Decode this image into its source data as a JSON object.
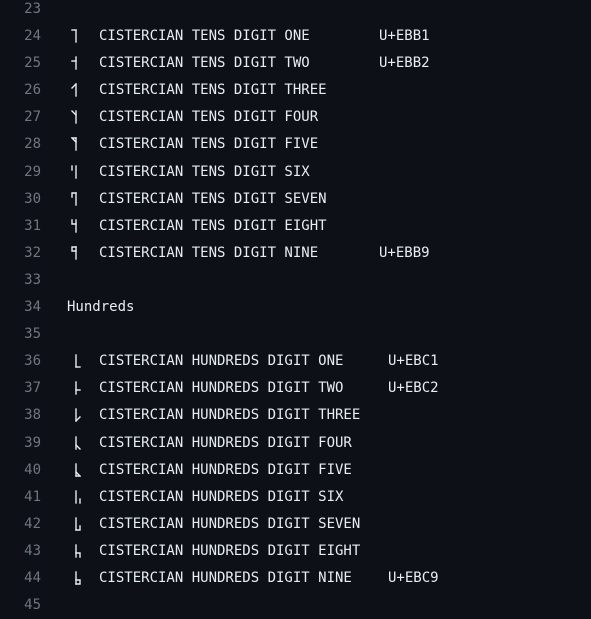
{
  "editor": {
    "lines": [
      {
        "num": "23",
        "text": ""
      },
      {
        "num": "24",
        "glyph": "tens-1",
        "name": "CISTERCIAN TENS DIGIT ONE",
        "cp": "U+EBB1"
      },
      {
        "num": "25",
        "glyph": "tens-2",
        "name": "CISTERCIAN TENS DIGIT TWO",
        "cp": "U+EBB2"
      },
      {
        "num": "26",
        "glyph": "tens-3",
        "name": "CISTERCIAN TENS DIGIT THREE"
      },
      {
        "num": "27",
        "glyph": "tens-4",
        "name": "CISTERCIAN TENS DIGIT FOUR"
      },
      {
        "num": "28",
        "glyph": "tens-5",
        "name": "CISTERCIAN TENS DIGIT FIVE"
      },
      {
        "num": "29",
        "glyph": "tens-6",
        "name": "CISTERCIAN TENS DIGIT SIX"
      },
      {
        "num": "30",
        "glyph": "tens-7",
        "name": "CISTERCIAN TENS DIGIT SEVEN"
      },
      {
        "num": "31",
        "glyph": "tens-8",
        "name": "CISTERCIAN TENS DIGIT EIGHT"
      },
      {
        "num": "32",
        "glyph": "tens-9",
        "name": "CISTERCIAN TENS DIGIT NINE",
        "cp": "U+EBB9"
      },
      {
        "num": "33",
        "text": ""
      },
      {
        "num": "34",
        "text": "Hundreds"
      },
      {
        "num": "35",
        "text": ""
      },
      {
        "num": "36",
        "glyph": "hund-1",
        "name": "CISTERCIAN HUNDREDS DIGIT ONE",
        "cp": "U+EBC1"
      },
      {
        "num": "37",
        "glyph": "hund-2",
        "name": "CISTERCIAN HUNDREDS DIGIT TWO",
        "cp": "U+EBC2"
      },
      {
        "num": "38",
        "glyph": "hund-3",
        "name": "CISTERCIAN HUNDREDS DIGIT THREE"
      },
      {
        "num": "39",
        "glyph": "hund-4",
        "name": "CISTERCIAN HUNDREDS DIGIT FOUR"
      },
      {
        "num": "40",
        "glyph": "hund-5",
        "name": "CISTERCIAN HUNDREDS DIGIT FIVE"
      },
      {
        "num": "41",
        "glyph": "hund-6",
        "name": "CISTERCIAN HUNDREDS DIGIT SIX"
      },
      {
        "num": "42",
        "glyph": "hund-7",
        "name": "CISTERCIAN HUNDREDS DIGIT SEVEN"
      },
      {
        "num": "43",
        "glyph": "hund-8",
        "name": "CISTERCIAN HUNDREDS DIGIT EIGHT"
      },
      {
        "num": "44",
        "glyph": "hund-9",
        "name": "CISTERCIAN HUNDREDS DIGIT NINE",
        "cp": "U+EBC9"
      },
      {
        "num": "45",
        "text": ""
      }
    ]
  },
  "colors": {
    "background": "#0d1117",
    "text": "#e6edf3",
    "line_number": "#6e7681"
  }
}
